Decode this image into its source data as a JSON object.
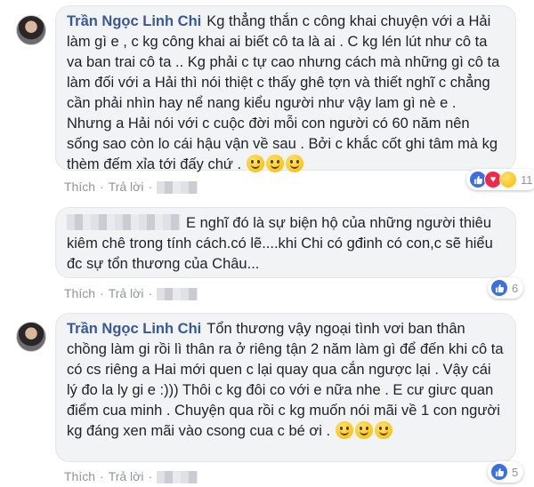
{
  "comments": [
    {
      "author": "Trần Ngọc Linh Chi",
      "text": "Kg thẳng thắn c công khai chuyện với a Hải làm gì e , c kg công khai ai biết cô ta là ai . C kg lén lút như cô ta va ban trai cô ta .. Kg phải c tự cao nhưng cách mà những gì cô ta làm đối với a Hải thì nói thiệt c thấy ghê tợn và thiết nghĩ c chẳng cần phải nhìn hay nể nang kiểu người như vậy lam gì nè e . Nhưng a Hải nói với c cuộc đời mỗi con người có 60 năm nên sống sao còn lo cái hậu vận về sau . Bởi c khắc cốt ghi tâm mà kg thèm đếm xỉa tới đấy chứ .",
      "like_label": "Thích",
      "reply_label": "Trả lời",
      "reaction_count": "11",
      "reaction_icons": [
        "like-icon",
        "love-icon",
        "haha-icon"
      ]
    },
    {
      "author": "",
      "text": "E nghĩ đó là sự biện hộ của những người thiêu kiêm chê trong tính cách.có lẽ....khi Chi có gđinh có con,c sẽ hiểu đc sự tổn thương của Châu...",
      "like_label": "Thích",
      "reply_label": "Trả lời",
      "reaction_count": "6",
      "reaction_icons": [
        "like-icon"
      ]
    },
    {
      "author": "Trần Ngọc Linh Chi",
      "text": "Tổn thương vậy ngoại tình vơi ban thân chồng làm gi rồi lì thân ra ở riêng tận 2 năm làm gì để đến khi cô ta có cs riêng a Hai mới quen c lại quay qua cắn ngược lại . Vậy cái lý đo la ly gi e :))) Thôi c kg đôi co với e nữa nhe . E cư giưc quan điểm cua minh . Chuyện qua rồi c kg muốn nói mãi về 1 con người kg đáng xen mãi vào csong cua c bé ơi .",
      "like_label": "Thích",
      "reply_label": "Trả lời",
      "reaction_count": "5",
      "reaction_icons": [
        "like-icon"
      ]
    }
  ],
  "separator": "·",
  "colors": {
    "author": "#385898",
    "bubble": "#f2f3f5",
    "meta": "#90949c",
    "like": "#3b6fe0",
    "love": "#f0284a"
  }
}
